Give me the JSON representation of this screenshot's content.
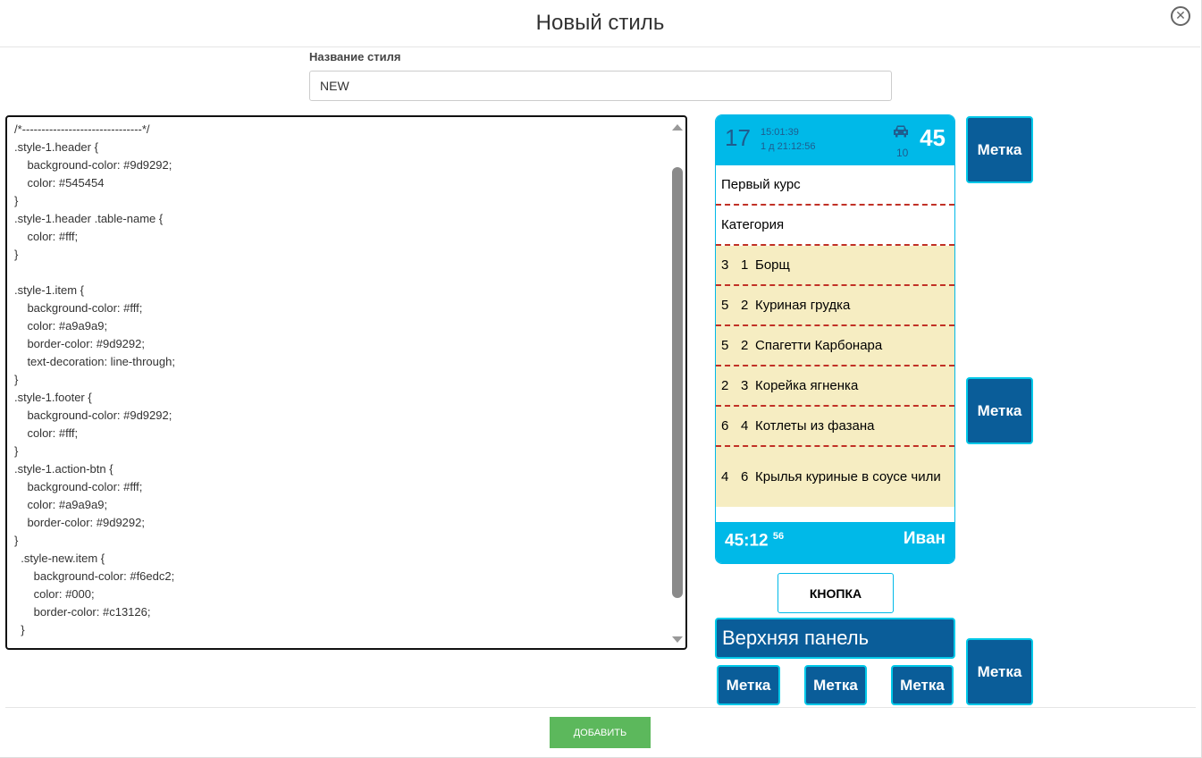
{
  "modal": {
    "title": "Новый стиль"
  },
  "form": {
    "name_label": "Название стиля",
    "name_value": "NEW"
  },
  "editor": {
    "code": "/*-----*/\n/*-------------------------------*/\n.style-1.header {\n    background-color: #9d9292;\n    color: #545454\n}\n.style-1.header .table-name {\n    color: #fff;\n}\n\n.style-1.item {\n    background-color: #fff;\n    color: #a9a9a9;\n    border-color: #9d9292;\n    text-decoration: line-through;\n}\n.style-1.footer {\n    background-color: #9d9292;\n    color: #fff;\n}\n.style-1.action-btn {\n    background-color: #fff;\n    color: #a9a9a9;\n    border-color: #9d9292;\n}\n  .style-new.item {\n      background-color: #f6edc2;\n      color: #000;\n      border-color: #c13126;\n  }"
  },
  "preview": {
    "table_number": "17",
    "time": "15:01:39",
    "elapsed": "1 д 21:12:56",
    "car_count": "10",
    "order_count": "45",
    "course": "Первый курс",
    "category": "Категория",
    "items": [
      {
        "qty": "3",
        "course": "1",
        "name": "Борщ"
      },
      {
        "qty": "5",
        "course": "2",
        "name": "Куриная грудка"
      },
      {
        "qty": "5",
        "course": "2",
        "name": "Спагетти Карбонара"
      },
      {
        "qty": "2",
        "course": "3",
        "name": "Корейка ягненка"
      },
      {
        "qty": "6",
        "course": "4",
        "name": "Котлеты из фазана"
      },
      {
        "qty": "4",
        "course": "6",
        "name": "Крылья куриные в соусе чили"
      }
    ],
    "footer_time": "45:12",
    "footer_seconds": "56",
    "waiter": "Иван",
    "button_label": "КНОПКА",
    "top_panel": "Верхняя панель",
    "tag_label": "Метка"
  },
  "actions": {
    "add_label": "ДОБАВИТЬ"
  },
  "colors": {
    "header": "#00b9e8",
    "item_bg": "#f6edc2",
    "border": "#c13126",
    "tag_bg": "#0a5d99",
    "add_btn": "#5cb85c"
  }
}
